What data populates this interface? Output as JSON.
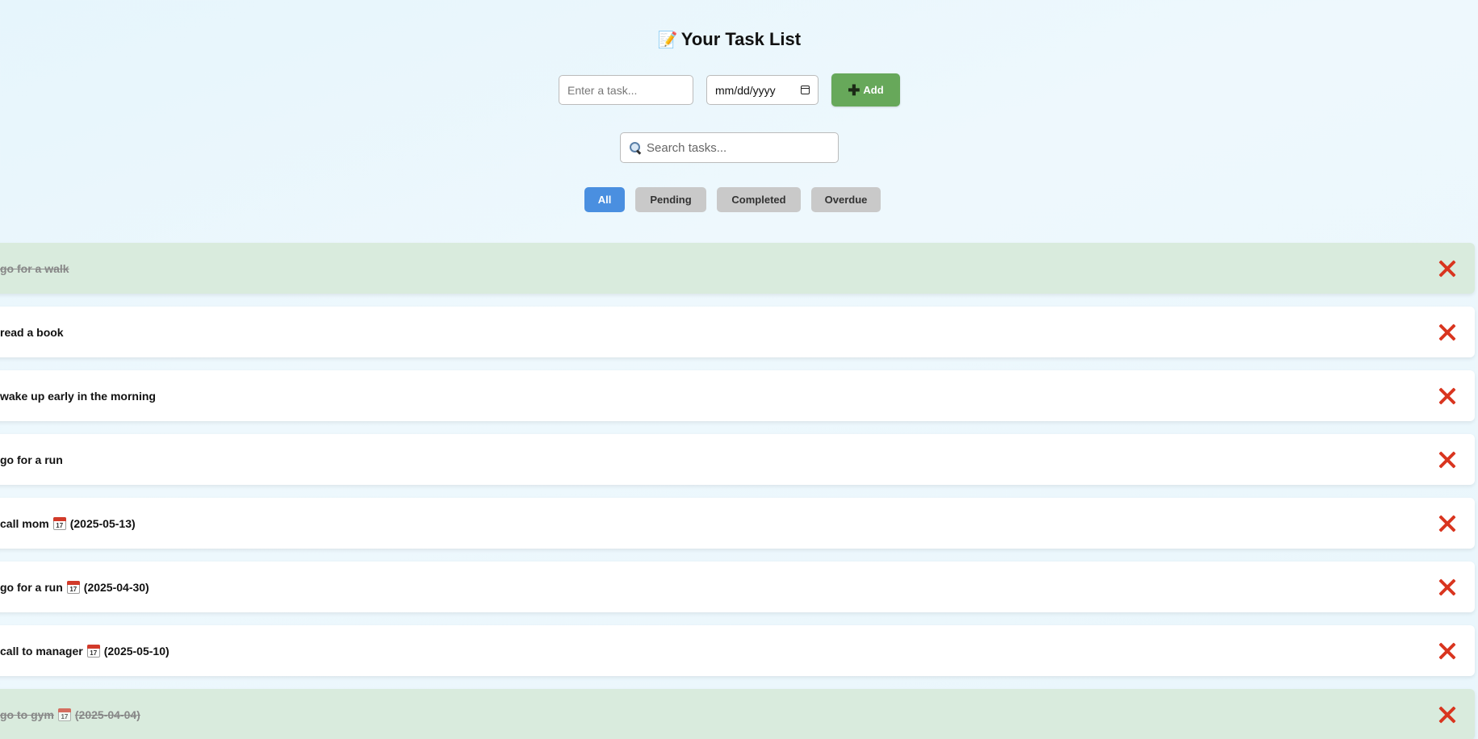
{
  "header": {
    "icon": "memo-icon",
    "icon_glyph": "📝",
    "title": "Your Task List"
  },
  "add_form": {
    "task_placeholder": "Enter a task...",
    "task_value": "",
    "date_placeholder": "mm/dd/yyyy",
    "add_icon": "plus-icon",
    "add_label": "Add"
  },
  "search": {
    "icon": "search-icon",
    "placeholder": "Search tasks...",
    "value": ""
  },
  "filters": [
    {
      "label": "All",
      "active": true
    },
    {
      "label": "Pending",
      "active": false
    },
    {
      "label": "Completed",
      "active": false
    },
    {
      "label": "Overdue",
      "active": false
    }
  ],
  "tasks": [
    {
      "text": "go for a walk",
      "date": "",
      "completed": true
    },
    {
      "text": "read a book",
      "date": "",
      "completed": false
    },
    {
      "text": "wake up early in the morning",
      "date": "",
      "completed": false
    },
    {
      "text": "go for a run",
      "date": "",
      "completed": false
    },
    {
      "text": "call mom",
      "date": "(2025-05-13)",
      "completed": false
    },
    {
      "text": "go for a run",
      "date": "(2025-04-30)",
      "completed": false
    },
    {
      "text": "call to manager",
      "date": "(2025-05-10)",
      "completed": false
    },
    {
      "text": "go to gym",
      "date": "(2025-04-04)",
      "completed": true
    }
  ],
  "colors": {
    "accent_blue": "#4a8fe0",
    "add_green": "#67a85a",
    "completed_row": "#d9ebdd",
    "delete_red": "#d9351f"
  }
}
